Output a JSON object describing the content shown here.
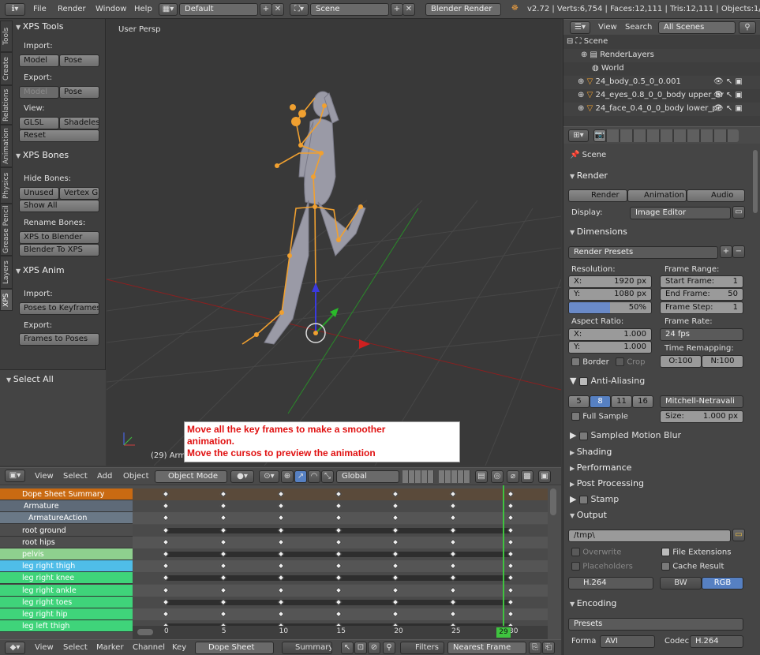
{
  "topbar": {
    "menus": [
      "File",
      "Render",
      "Window",
      "Help"
    ],
    "layout": "Default",
    "scene": "Scene",
    "engine": "Blender Render",
    "stats": "v2.72 | Verts:6,754 | Faces:12,111 | Tris:12,111 | Objects:1/14 | Lam"
  },
  "toolshelf": {
    "tabs": [
      "Tools",
      "Create",
      "Relations",
      "Animation",
      "Physics",
      "Grease Pencil",
      "Layers",
      "XPS"
    ],
    "xps_tools": "XPS Tools",
    "import_label": "Import:",
    "model": "Model",
    "pose": "Pose",
    "export_label": "Export:",
    "view_label": "View:",
    "glsl": "GLSL",
    "shadeless": "Shadeless",
    "reset": "Reset",
    "xps_bones": "XPS Bones",
    "hide_bones": "Hide Bones:",
    "unused": "Unused",
    "vertex_gr": "Vertex Gr",
    "show_all": "Show All",
    "rename_bones": "Rename Bones:",
    "xps_to_blender": "XPS to Blender",
    "blender_to_xps": "Blender To XPS",
    "xps_anim": "XPS Anim",
    "poses_to_keyframes": "Poses to Keyframes",
    "frames_to_poses": "Frames to Poses",
    "select_all": "Select All"
  },
  "viewport": {
    "label": "User Persp",
    "object_label": "(29) Arma",
    "annotation_line1": "Move all the key frames to make a smoother",
    "annotation_line2": "animation.",
    "annotation_line3": "Move the cursos to preview the animation",
    "header": {
      "menus": [
        "View",
        "Select",
        "Add",
        "Object"
      ],
      "mode": "Object Mode",
      "orientation": "Global"
    }
  },
  "outliner": {
    "menus": [
      "View",
      "Search"
    ],
    "filter": "All Scenes",
    "items": [
      "Scene",
      "RenderLayers",
      "World",
      "24_body_0.5_0_0.001",
      "24_eyes_0.8_0_0_body upper_br",
      "24_face_0.4_0_0_body lower_pe"
    ]
  },
  "properties": {
    "context": "Scene",
    "render": {
      "title": "Render",
      "render_btn": "Render",
      "animation_btn": "Animation",
      "audio_btn": "Audio",
      "display_label": "Display:",
      "display_value": "Image Editor"
    },
    "dimensions": {
      "title": "Dimensions",
      "presets": "Render Presets",
      "resolution_label": "Resolution:",
      "res_x": "X:",
      "res_x_val": "1920 px",
      "res_y": "Y:",
      "res_y_val": "1080 px",
      "res_pct": "50%",
      "frame_range_label": "Frame Range:",
      "start_label": "Start Frame:",
      "start_val": "1",
      "end_label": "End Frame:",
      "end_val": "50",
      "step_label": "Frame Step:",
      "step_val": "1",
      "aspect_label": "Aspect Ratio:",
      "asp_x": "X:",
      "asp_x_val": "1.000",
      "asp_y": "Y:",
      "asp_y_val": "1.000",
      "frame_rate_label": "Frame Rate:",
      "frame_rate": "24 fps",
      "time_remap_label": "Time Remapping:",
      "remap_o": "O:100",
      "remap_n": "N:100",
      "border": "Border",
      "crop": "Crop"
    },
    "aa": {
      "title": "Anti-Aliasing",
      "samples": [
        "5",
        "8",
        "11",
        "16"
      ],
      "filter": "Mitchell-Netravali",
      "full_sample": "Full Sample",
      "size_label": "Size:",
      "size_val": "1.000 px"
    },
    "collapsed": [
      "Sampled Motion Blur",
      "Shading",
      "Performance",
      "Post Processing",
      "Stamp"
    ],
    "output": {
      "title": "Output",
      "path": "/tmp\\",
      "overwrite": "Overwrite",
      "file_ext": "File Extensions",
      "placeholders": "Placeholders",
      "cache": "Cache Result",
      "format": "H.264",
      "bw": "BW",
      "rgb": "RGB"
    },
    "encoding": {
      "title": "Encoding",
      "presets": "Presets",
      "format_label": "Forma",
      "format_val": "AVI",
      "codec_label": "Codec",
      "codec_val": "H.264"
    }
  },
  "dopesheet": {
    "rows": [
      {
        "name": "Dope Sheet Summary",
        "color": "#c96a12"
      },
      {
        "name": "Armature",
        "color": "#5e6a78"
      },
      {
        "name": "ArmatureAction",
        "color": "#6a7886"
      },
      {
        "name": "root ground",
        "color": "#4d4d4d"
      },
      {
        "name": "root hips",
        "color": "#4d4d4d"
      },
      {
        "name": "pelvis",
        "color": "#8ed08e"
      },
      {
        "name": "leg right thigh",
        "color": "#4fbde8"
      },
      {
        "name": "leg right knee",
        "color": "#3fd47a"
      },
      {
        "name": "leg right ankle",
        "color": "#3fd47a"
      },
      {
        "name": "leg right toes",
        "color": "#3fd47a"
      },
      {
        "name": "leg right hip",
        "color": "#3fd47a"
      },
      {
        "name": "leg left thigh",
        "color": "#3fd47a"
      }
    ],
    "frames": [
      0,
      5,
      10,
      15,
      20,
      25,
      30
    ],
    "current_frame": "29",
    "header": {
      "menus": [
        "View",
        "Select",
        "Marker",
        "Channel",
        "Key"
      ],
      "mode": "Dope Sheet",
      "summary": "Summary",
      "filters": "Filters",
      "interp": "Nearest Frame"
    }
  }
}
